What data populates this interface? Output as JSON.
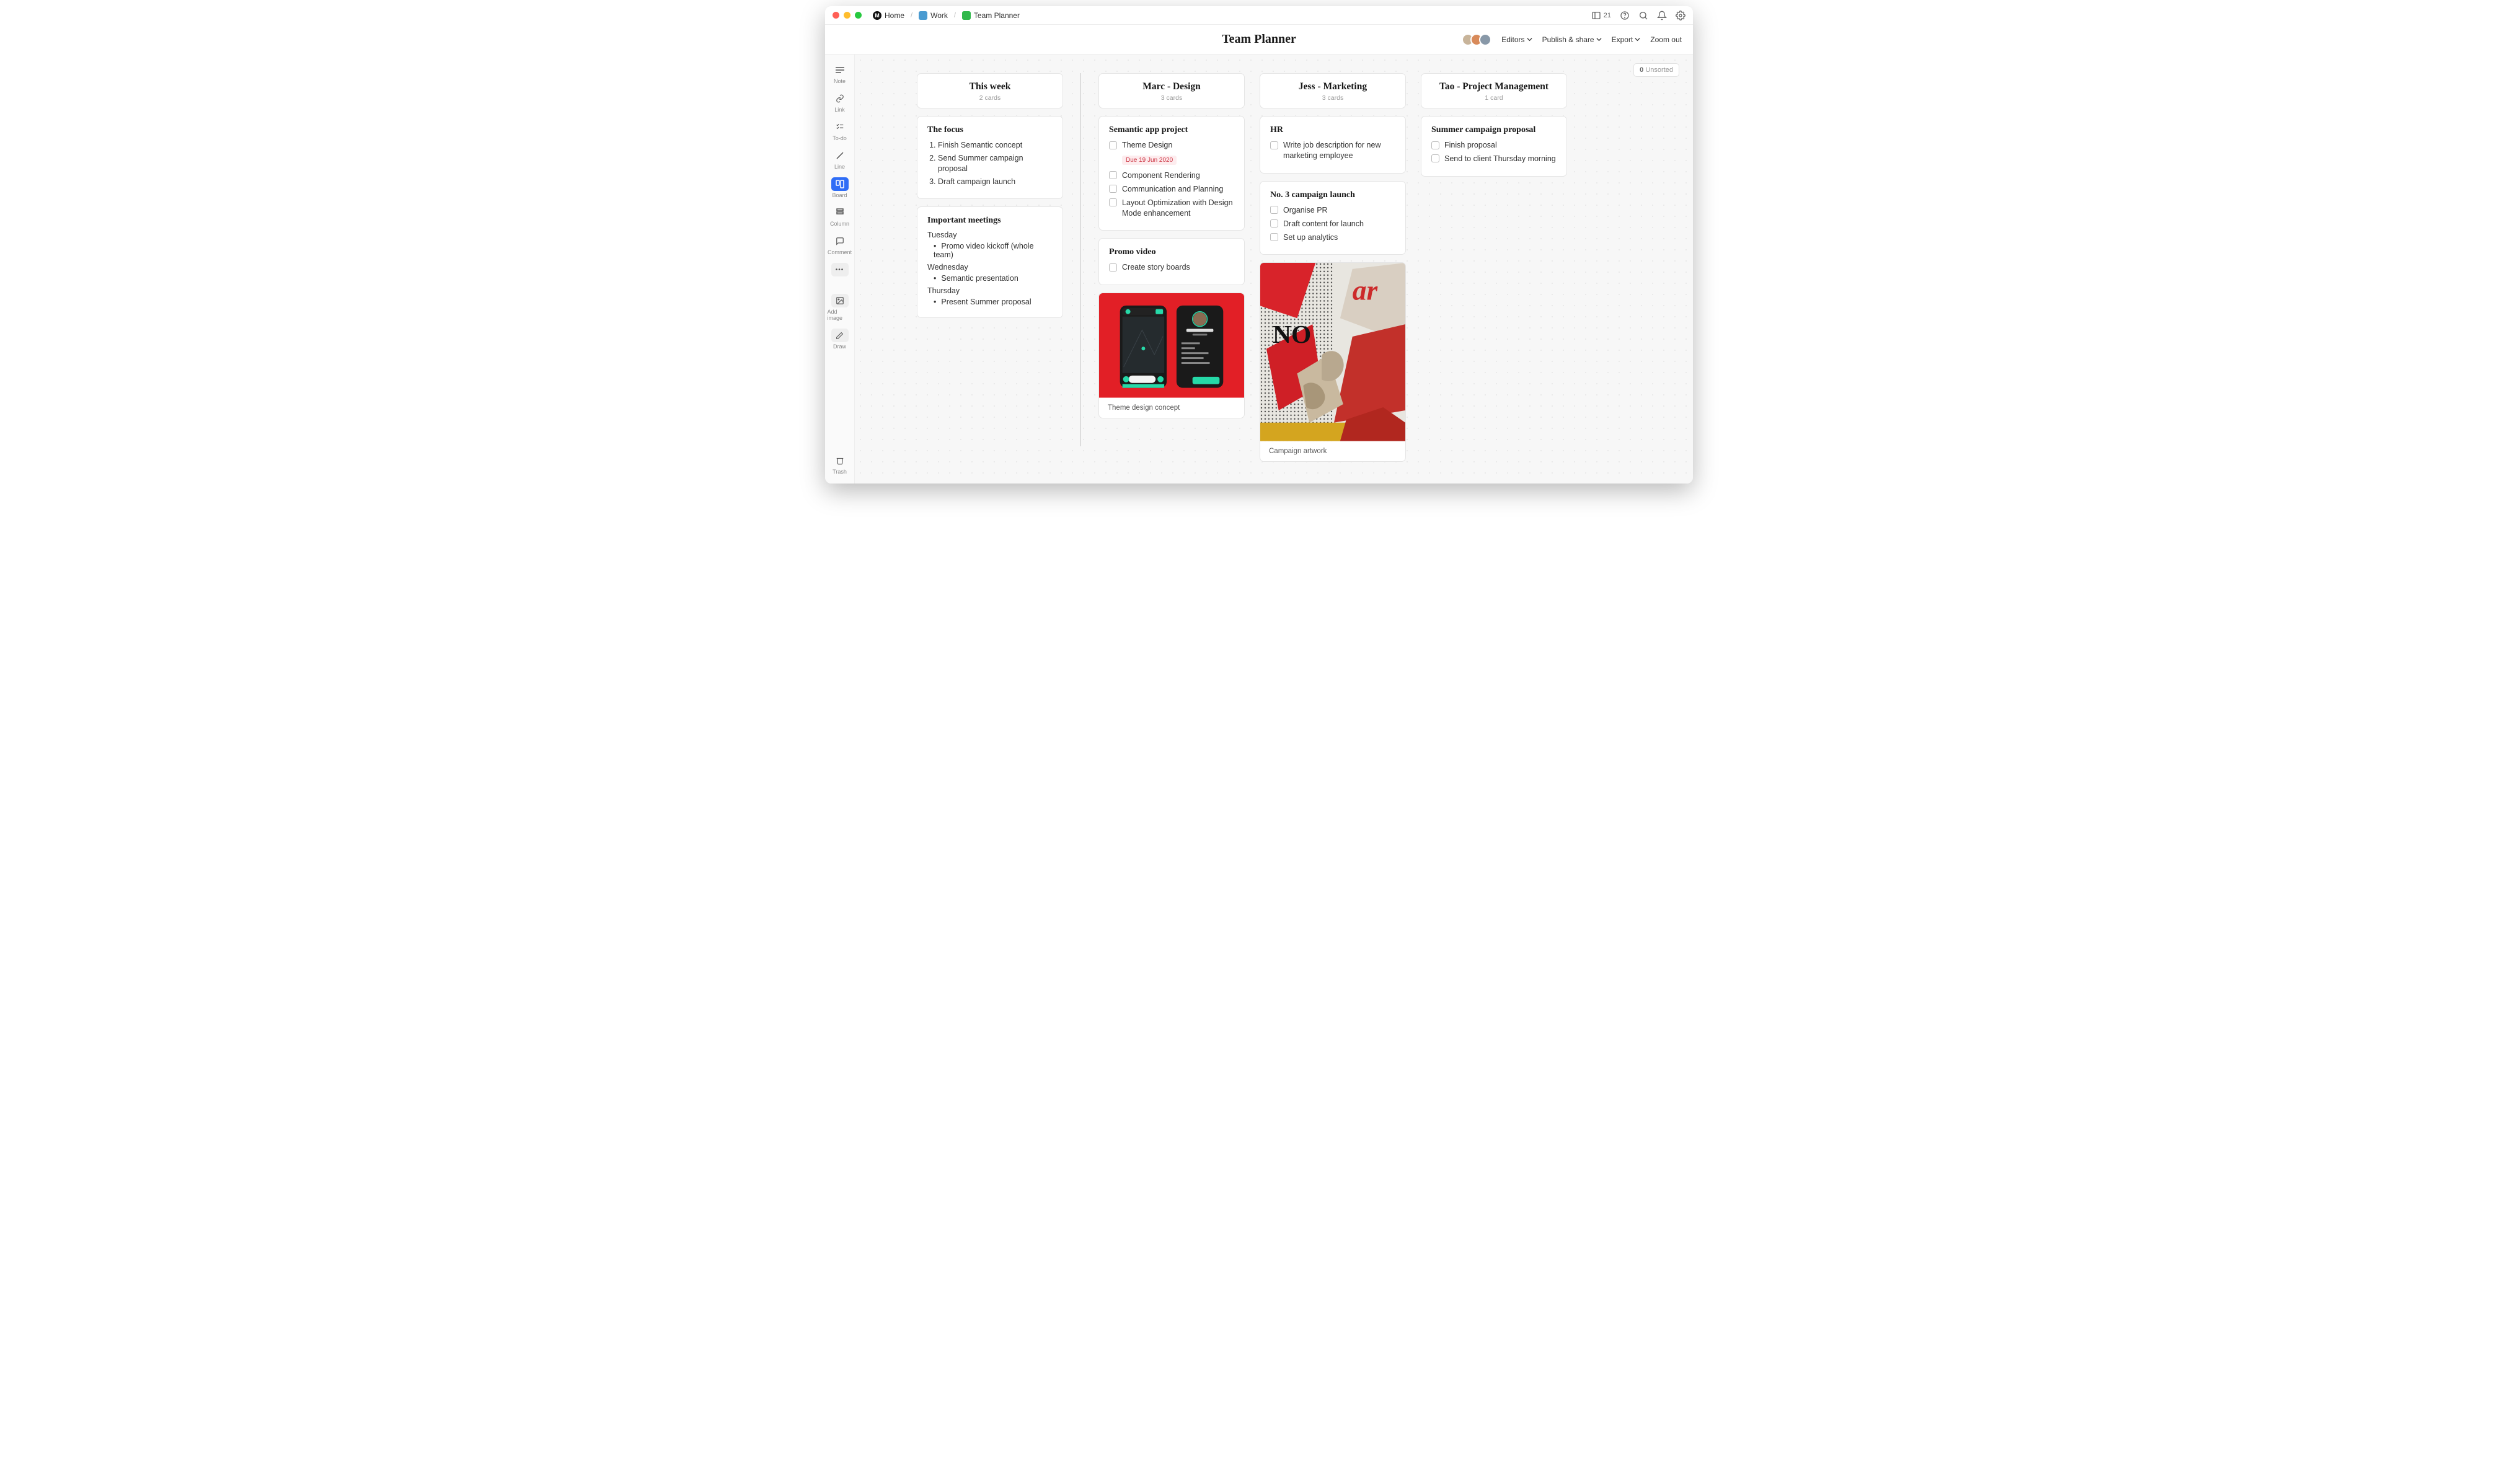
{
  "breadcrumbs": {
    "home": "Home",
    "work": "Work",
    "teamplanner": "Team Planner"
  },
  "topbar": {
    "sidebar_count": "21"
  },
  "header": {
    "title": "Team Planner",
    "editors": "Editors",
    "publish": "Publish & share",
    "export": "Export",
    "zoomout": "Zoom out"
  },
  "tools": {
    "note": "Note",
    "link": "Link",
    "todo": "To-do",
    "line": "Line",
    "board": "Board",
    "column": "Column",
    "comment": "Comment",
    "more": "•••",
    "addimage": "Add image",
    "draw": "Draw",
    "trash": "Trash"
  },
  "unsorted": {
    "count": "0",
    "label": "Unsorted"
  },
  "columns": {
    "thisweek": {
      "title": "This week",
      "sub": "2 cards",
      "focus": {
        "heading": "The focus",
        "items": [
          "Finish Semantic concept",
          "Send Summer campaign proposal",
          "Draft campaign launch"
        ]
      },
      "meetings": {
        "heading": "Important meetings",
        "tuesday_label": "Tuesday",
        "tuesday_item": "Promo video kickoff (whole team)",
        "wednesday_label": "Wednesday",
        "wednesday_item": "Semantic presentation",
        "thursday_label": "Thursday",
        "thursday_item": "Present Summer proposal"
      }
    },
    "marc": {
      "title": "Marc - Design",
      "sub": "3 cards",
      "semantic": {
        "heading": "Semantic app project",
        "theme": "Theme Design",
        "due": "Due 19 Jun 2020",
        "items": [
          "Component Rendering",
          "Communication and Planning",
          "Layout Optimization with Design Mode enhancement"
        ]
      },
      "promo": {
        "heading": "Promo video",
        "item": "Create story boards"
      },
      "image_caption": "Theme design concept"
    },
    "jess": {
      "title": "Jess - Marketing",
      "sub": "3 cards",
      "hr": {
        "heading": "HR",
        "item": "Write job description for new marketing employee"
      },
      "campaign": {
        "heading": "No. 3 campaign launch",
        "items": [
          "Organise PR",
          "Draft content for launch",
          "Set up analytics"
        ]
      },
      "image_caption": "Campaign artwork"
    },
    "tao": {
      "title": "Tao - Project Management",
      "sub": "1 card",
      "summer": {
        "heading": "Summer campaign proposal",
        "items": [
          "Finish proposal",
          "Send to client Thursday morning"
        ]
      }
    }
  }
}
